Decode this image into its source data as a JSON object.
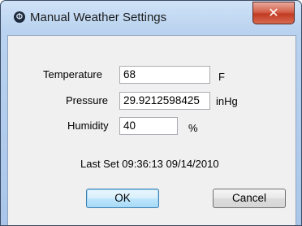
{
  "window": {
    "title": "Manual Weather Settings",
    "icon": "weather-app-icon",
    "close_glyph": "✕"
  },
  "fields": {
    "temperature": {
      "label": "Temperature",
      "value": "68",
      "unit": "F"
    },
    "pressure": {
      "label": "Pressure",
      "value": "29.9212598425",
      "unit": "inHg"
    },
    "humidity": {
      "label": "Humidity",
      "value": "40",
      "unit": "%"
    }
  },
  "status": {
    "last_set": "Last Set 09:36:13 09/14/2010"
  },
  "buttons": {
    "ok": "OK",
    "cancel": "Cancel"
  },
  "colors": {
    "title_bar": "#b9d2ef",
    "close_button": "#c23b24",
    "dialog_bg": "#f0f0f0",
    "default_button": "#a7d9f5"
  }
}
